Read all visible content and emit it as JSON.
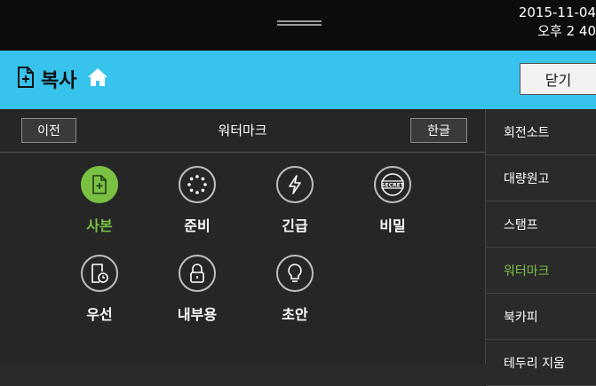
{
  "status": {
    "date": "2015-11-04",
    "time": "오후 2 40"
  },
  "header": {
    "title": "복사",
    "close_label": "닫기"
  },
  "toolbar": {
    "prev_label": "이전",
    "section_title": "워터마크",
    "lang_label": "한글"
  },
  "options": [
    {
      "label": "사본",
      "icon": "copy-doc-icon",
      "active": true
    },
    {
      "label": "준비",
      "icon": "dotted-circle-icon",
      "active": false
    },
    {
      "label": "긴급",
      "icon": "lightning-icon",
      "active": false
    },
    {
      "label": "비밀",
      "icon": "secret-stamp-icon",
      "active": false
    },
    {
      "label": "우선",
      "icon": "clock-doc-icon",
      "active": false
    },
    {
      "label": "내부용",
      "icon": "lock-icon",
      "active": false
    },
    {
      "label": "초안",
      "icon": "lightbulb-icon",
      "active": false
    }
  ],
  "sidebar": {
    "items": [
      {
        "label": "회전소트",
        "active": false
      },
      {
        "label": "대량원고",
        "active": false
      },
      {
        "label": "스탬프",
        "active": false
      },
      {
        "label": "워터마크",
        "active": true
      },
      {
        "label": "북카피",
        "active": false
      },
      {
        "label": "테두리 지움",
        "active": false
      }
    ]
  },
  "colors": {
    "accent": "#7ac143",
    "header": "#38c3ec"
  }
}
